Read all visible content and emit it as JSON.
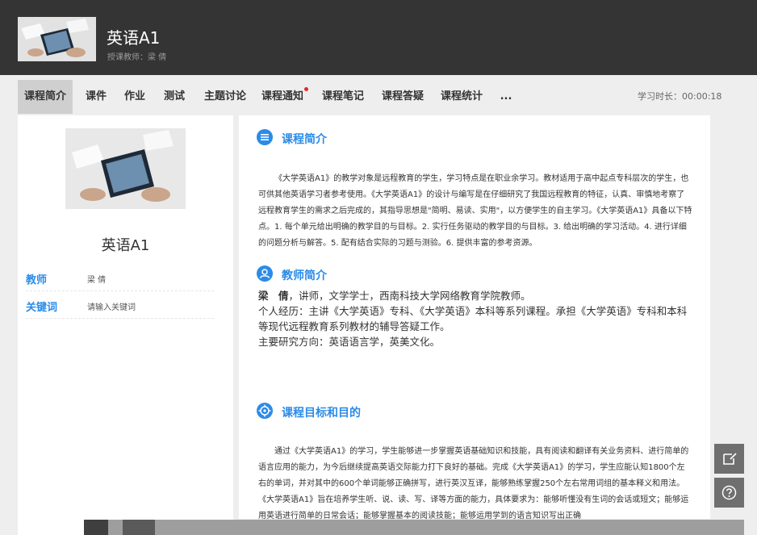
{
  "header": {
    "title": "英语A1",
    "subtitle": "授课教师：梁 倩"
  },
  "nav": {
    "tabs": [
      {
        "label": "课程简介",
        "active": true
      },
      {
        "label": "课件"
      },
      {
        "label": "作业"
      },
      {
        "label": "测试"
      },
      {
        "label": "主题讨论"
      },
      {
        "label": "课程通知",
        "badge": "red-dot"
      },
      {
        "label": "课程笔记"
      },
      {
        "label": "课程答疑"
      },
      {
        "label": "课程统计"
      },
      {
        "label": "..."
      }
    ],
    "study_time": "学习时长：00:00:18"
  },
  "sidebar": {
    "course_name": "英语A1",
    "teacher_label": "教师",
    "teacher_value": "梁 倩",
    "keyword_label": "关键词",
    "keyword_value": "请输入关键词"
  },
  "sections": {
    "intro": {
      "title": "课程简介",
      "text": "《大学英语A1》的教学对象是远程教育的学生，学习特点是在职业余学习。教材适用于高中起点专科层次的学生，也可供其他英语学习者参考使用。《大学英语A1》的设计与编写是在仔细研究了我国远程教育的特征，认真、审慎地考察了远程教育学生的需求之后完成的，其指导思想是\"简明、易读、实用\"，以方便学生的自主学习。《大学英语A1》具备以下特点。1. 每个单元给出明确的教学目的与目标。2. 实行任务驱动的教学目的与目标。3. 给出明确的学习活动。4. 进行详细的问题分析与解答。5. 配有结合实际的习题与测验。6. 提供丰富的参考资源。"
    },
    "teacher": {
      "title": "教师简介",
      "name": "梁　倩",
      "line1_rest": "，讲师，文学学士，西南科技大学网络教育学院教师。",
      "line2": "个人经历：主讲《大学英语》专科、《大学英语》本科等系列课程。承担《大学英语》专科和本科等现代远程教育系列教材的辅导答疑工作。",
      "line3": "主要研究方向：英语语言学，英美文化。"
    },
    "goals": {
      "title": "课程目标和目的",
      "text": "通过《大学英语A1》的学习，学生能够进一步掌握英语基础知识和技能，具有阅读和翻译有关业务资料、进行简单的语言应用的能力，为今后继续提高英语交际能力打下良好的基础。完成《大学英语A1》的学习，学生应能认知1800个左右的单词，并对其中的600个单词能够正确拼写，进行英汉互译，能够熟练掌握250个左右常用词组的基本释义和用法。《大学英语A1》旨在培养学生听、说、读、写、译等方面的能力，具体要求为：能够听懂没有生词的会话或短文；能够运用英语进行简单的日常会话；能够掌握基本的阅读技能；能够运用学到的语言知识写出正确"
    }
  },
  "icons": {
    "intro": "list-icon",
    "teacher": "person-icon",
    "goals": "target-icon",
    "note": "edit-note-icon",
    "help": "question-icon"
  },
  "colors": {
    "accent": "#2b8be8",
    "header_bg": "#343434",
    "badge": "#e02b2b"
  }
}
